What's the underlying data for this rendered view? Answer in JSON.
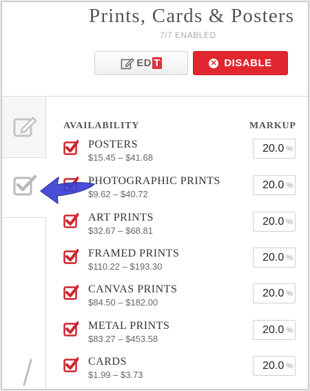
{
  "header": {
    "title": "Prints, Cards & Posters",
    "subtitle": "7/7 ENABLED",
    "edit_label_prefix": "ED",
    "edit_label_i": "I",
    "edit_label_t": "T",
    "disable_label": "DISABLE"
  },
  "colors": {
    "accent_red": "#e2262f",
    "arrow_blue": "#3b3fd6"
  },
  "sidebar": {
    "tabs": [
      {
        "icon": "edit-icon"
      },
      {
        "icon": "checkbox-icon"
      }
    ]
  },
  "table": {
    "availability_header": "AVAILABILITY",
    "markup_header": "MARKUP",
    "rows": [
      {
        "name": "POSTERS",
        "price": "$15.45 – $41.68",
        "markup": "20.0",
        "unit": "%"
      },
      {
        "name": "PHOTOGRAPHIC PRINTS",
        "price": "$9.62 – $40.72",
        "markup": "20.0",
        "unit": "%"
      },
      {
        "name": "ART PRINTS",
        "price": "$32.67 – $68.81",
        "markup": "20.0",
        "unit": "%"
      },
      {
        "name": "FRAMED PRINTS",
        "price": "$110.22 – $193.30",
        "markup": "20.0",
        "unit": "%"
      },
      {
        "name": "CANVAS PRINTS",
        "price": "$84.50 – $182.00",
        "markup": "20.0",
        "unit": "%"
      },
      {
        "name": "METAL PRINTS",
        "price": "$83.27 – $453.58",
        "markup": "20.0",
        "unit": "%"
      },
      {
        "name": "CARDS",
        "price": "$1.99 – $3.73",
        "markup": "20.0",
        "unit": "%"
      }
    ]
  }
}
